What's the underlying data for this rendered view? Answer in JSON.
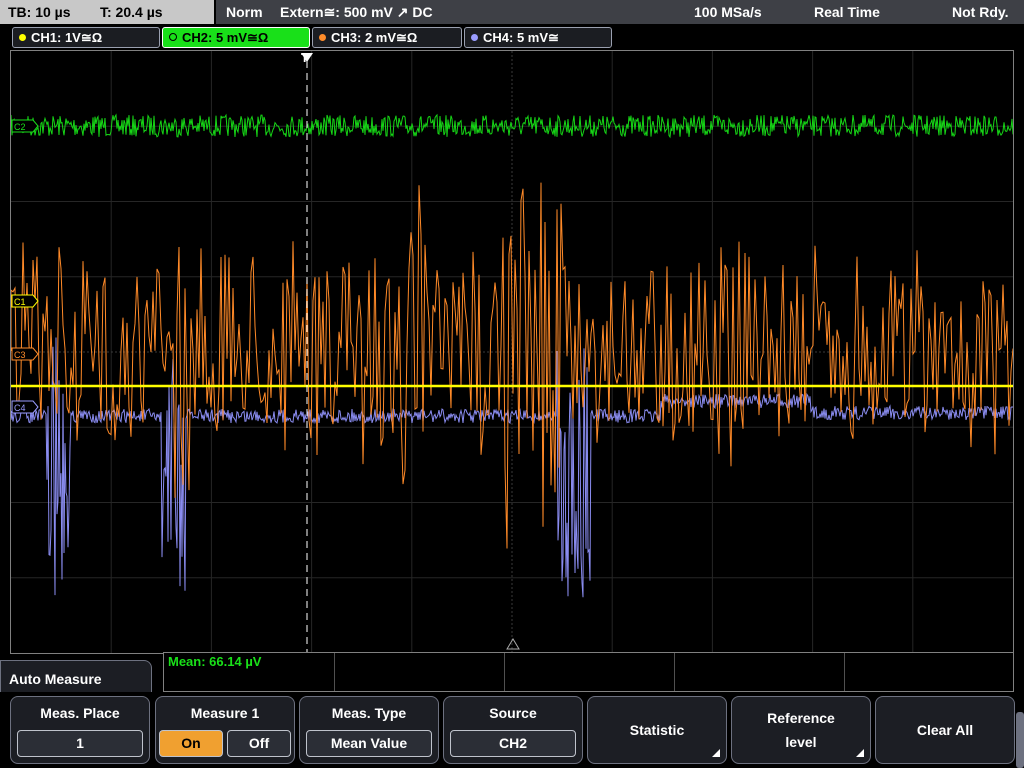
{
  "topbar": {
    "tb": "TB: 10 µs",
    "t": "T: 20.4 µs",
    "mode": "Norm",
    "trigger": "Extern≅: 500 mV ↗ DC",
    "rate": "100 MSa/s",
    "acq": "Real Time",
    "state": "Not Rdy."
  },
  "channels": [
    {
      "label": "CH1: 1V≅Ω",
      "color": "#ffff00"
    },
    {
      "label": "CH2: 5 mV≅Ω",
      "color": "#19e019"
    },
    {
      "label": "CH3: 2 mV≅Ω",
      "color": "#ff8c2a"
    },
    {
      "label": "CH4: 5 mV≅",
      "color": "#9a9cff"
    }
  ],
  "markers": {
    "c1": "C1",
    "c2": "C2",
    "c3": "C3",
    "c4": "C4",
    "trigger": "T"
  },
  "measurement": {
    "mean": "Mean: 66.14 µV"
  },
  "menu": {
    "header": "Auto Measure",
    "meas_place": {
      "title": "Meas. Place",
      "value": "1"
    },
    "measure1": {
      "title": "Measure 1",
      "on": "On",
      "off": "Off",
      "selected": "On"
    },
    "meas_type": {
      "title": "Meas. Type",
      "value": "Mean Value"
    },
    "source": {
      "title": "Source",
      "value": "CH2"
    },
    "statistic": "Statistic",
    "reference_level_1": "Reference",
    "reference_level_2": "level",
    "clear_all": "Clear All"
  }
}
